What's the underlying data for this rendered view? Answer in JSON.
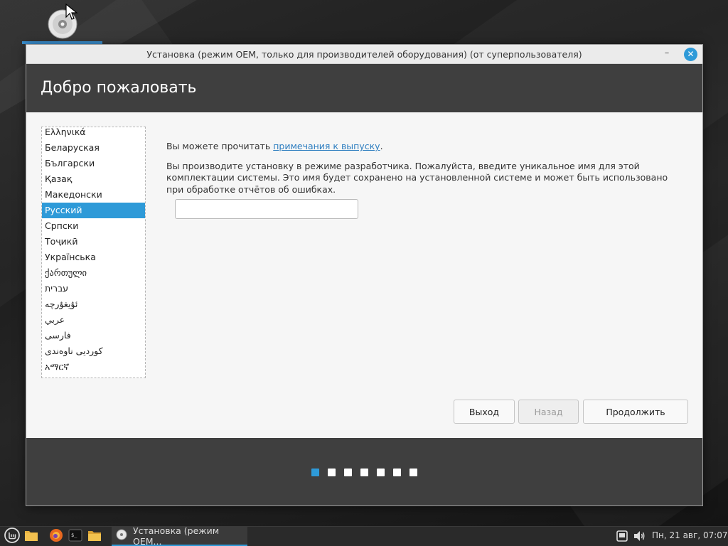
{
  "window": {
    "title": "Установка (режим OEM, только для производителей оборудования) (от суперпользователя)",
    "heading": "Добро пожаловать",
    "minimize_glyph": "–",
    "close_glyph": "✕"
  },
  "languages": {
    "items": [
      "Ελληνικά",
      "Беларуская",
      "Български",
      "Қазақ",
      "Македонски",
      "Русский",
      "Српски",
      "Тоҷикӣ",
      "Українська",
      "ქართული",
      "עברית",
      "ئۇيغۇرچە",
      "عربي",
      "فارسی",
      "کوردیی ناوەندی",
      "አማርኛ"
    ],
    "selected": "Русский"
  },
  "info": {
    "release_prefix": "Вы можете прочитать ",
    "release_link": "примечания к выпуску",
    "release_suffix": ".",
    "oem_text": "Вы производите установку в режиме разработчика. Пожалуйста, введите уникальное имя для этой комплектации системы. Это имя будет сохранено на установленной системе и может быть использовано при обработке отчётов об ошибках.",
    "name_value": ""
  },
  "buttons": {
    "quit": "Выход",
    "back": "Назад",
    "continue": "Продолжить"
  },
  "slideshow": {
    "total": 7,
    "active_index": 0
  },
  "taskbar": {
    "task_label": "Установка (режим OEM...",
    "clock": "Пн, 21 авг, 07:07",
    "terminal_glyph": "$_"
  },
  "colors": {
    "accent": "#2e9ad8",
    "header_bg": "#3f3f3f",
    "taskbar_bg": "#2a2a2a"
  },
  "icons": [
    "menu-icon",
    "files-icon",
    "firefox-icon",
    "terminal-icon",
    "folder-icon",
    "installer-icon",
    "network-icon",
    "volume-icon",
    "disc-icon"
  ]
}
